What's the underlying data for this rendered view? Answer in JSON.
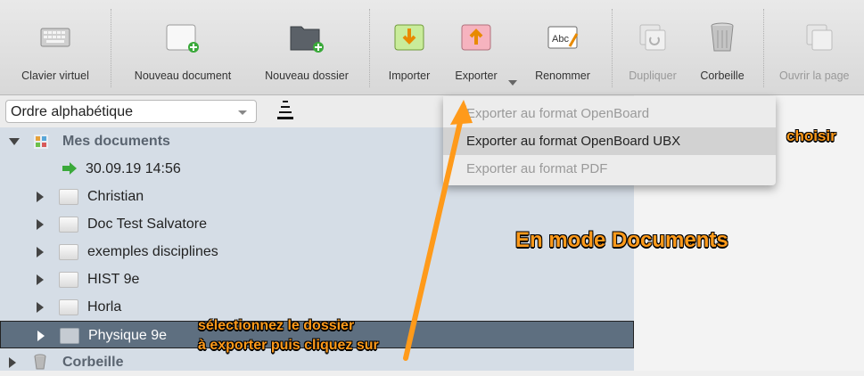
{
  "toolbar": {
    "items": [
      {
        "label": "Clavier virtuel",
        "icon": "keyboard-icon",
        "enabled": true
      },
      {
        "label": "Nouveau document",
        "icon": "new-document-icon",
        "enabled": true
      },
      {
        "label": "Nouveau dossier",
        "icon": "new-folder-icon",
        "enabled": true
      },
      {
        "label": "Importer",
        "icon": "import-icon",
        "enabled": true
      },
      {
        "label": "Exporter",
        "icon": "export-icon",
        "enabled": true
      },
      {
        "label": "Renommer",
        "icon": "rename-icon",
        "enabled": true
      },
      {
        "label": "Dupliquer",
        "icon": "duplicate-icon",
        "enabled": false
      },
      {
        "label": "Corbeille",
        "icon": "trash-icon",
        "enabled": true
      },
      {
        "label": "Ouvrir la page",
        "icon": "open-page-icon",
        "enabled": false
      }
    ]
  },
  "sort": {
    "selected": "Ordre alphabétique"
  },
  "tree": {
    "root": "Mes documents",
    "recent": "30.09.19 14:56",
    "folders": [
      "Christian",
      "Doc Test Salvatore",
      "exemples disciplines",
      "HIST 9e",
      "Horla",
      "Physique 9e"
    ],
    "selected_folder": "Physique 9e",
    "trash": "Corbeille"
  },
  "export_menu": {
    "items": [
      {
        "label": "Exporter au format OpenBoard",
        "enabled": false
      },
      {
        "label": "Exporter au format OpenBoard UBX",
        "enabled": true
      },
      {
        "label": "Exporter au format PDF",
        "enabled": false
      }
    ]
  },
  "annotations": {
    "choose": "choisir",
    "mode": "En mode Documents",
    "select_line1": "sélectionnez le dossier",
    "select_line2": "à exporter puis cliquez sur"
  },
  "colors": {
    "annotation": "#ff9a1a",
    "selected_row": "#5e6f80",
    "tree_bg": "#d5dde6"
  }
}
